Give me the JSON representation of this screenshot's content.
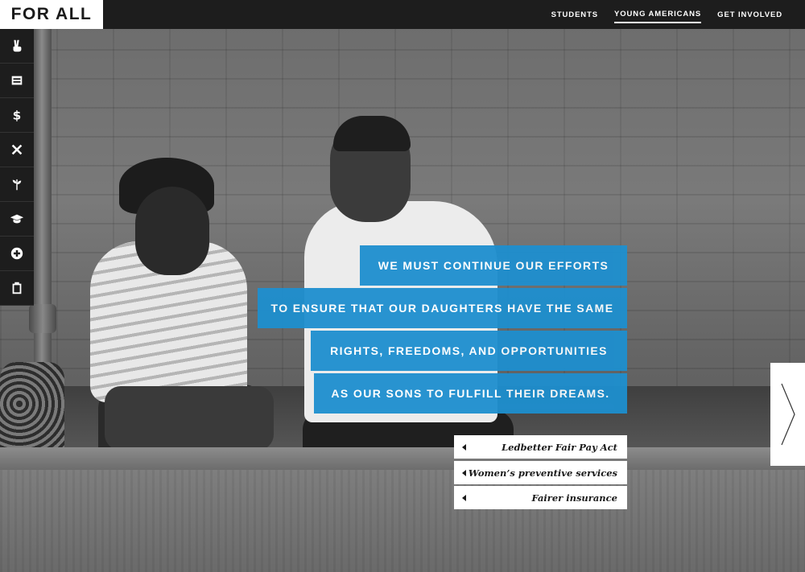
{
  "brand": {
    "logo": "FOR ALL"
  },
  "nav": {
    "items": [
      {
        "label": "STUDENTS"
      },
      {
        "label": "YOUNG AMERICANS"
      },
      {
        "label": "GET INVOLVED"
      }
    ],
    "active": "YOUNG AMERICANS"
  },
  "sidebar": {
    "icons": [
      "peace-hand-icon",
      "list-icon",
      "dollar-icon",
      "tools-icon",
      "plant-icon",
      "graduation-cap-icon",
      "plus-circle-icon",
      "clipboard-icon"
    ]
  },
  "quote": {
    "lines": [
      "WE MUST CONTINUE OUR EFFORTS",
      "TO ENSURE THAT OUR DAUGHTERS HAVE THE SAME",
      "RIGHTS, FREEDOMS, AND OPPORTUNITIES",
      "AS OUR SONS TO FULFILL THEIR DREAMS."
    ]
  },
  "links": [
    {
      "label": "Ledbetter Fair Pay Act"
    },
    {
      "label": "Women’s preventive services"
    },
    {
      "label": "Fairer insurance"
    }
  ],
  "colors": {
    "accent": "#1e8fcf",
    "topbar": "#1d1d1d",
    "white": "#ffffff"
  }
}
